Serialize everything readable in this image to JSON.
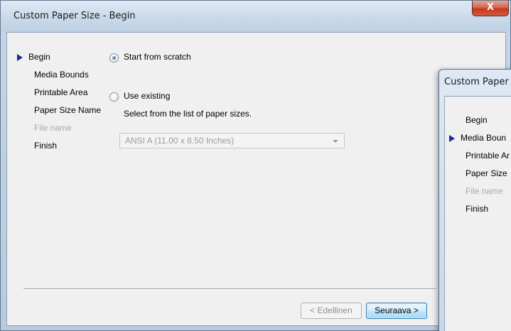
{
  "window": {
    "title": "Custom Paper Size - Begin",
    "close_label": "X"
  },
  "steps": [
    {
      "label": "Begin",
      "current": true,
      "enabled": true
    },
    {
      "label": "Media Bounds",
      "current": false,
      "enabled": true
    },
    {
      "label": "Printable Area",
      "current": false,
      "enabled": true
    },
    {
      "label": "Paper Size Name",
      "current": false,
      "enabled": true
    },
    {
      "label": "File name",
      "current": false,
      "enabled": false
    },
    {
      "label": "Finish",
      "current": false,
      "enabled": true
    }
  ],
  "options": {
    "scratch_label": "Start from scratch",
    "scratch_selected": true,
    "existing_label": "Use existing",
    "existing_selected": false,
    "existing_hint": "Select from the list of paper sizes.",
    "paper_select_value": "ANSI A (11.00 x 8.50 Inches)"
  },
  "buttons": {
    "back": "< Edellinen",
    "next": "Seuraava >"
  },
  "second_window": {
    "title": "Custom Paper",
    "steps": [
      {
        "label": "Begin",
        "current": false,
        "enabled": true
      },
      {
        "label": "Media Boun",
        "current": true,
        "enabled": true
      },
      {
        "label": "Printable Ar",
        "current": false,
        "enabled": true
      },
      {
        "label": "Paper Size",
        "current": false,
        "enabled": true
      },
      {
        "label": "File name",
        "current": false,
        "enabled": false
      },
      {
        "label": "Finish",
        "current": false,
        "enabled": true
      }
    ]
  },
  "colors": {
    "current_step_arrow": "#1a2ba0",
    "disabled_text": "#a9a9a9"
  }
}
